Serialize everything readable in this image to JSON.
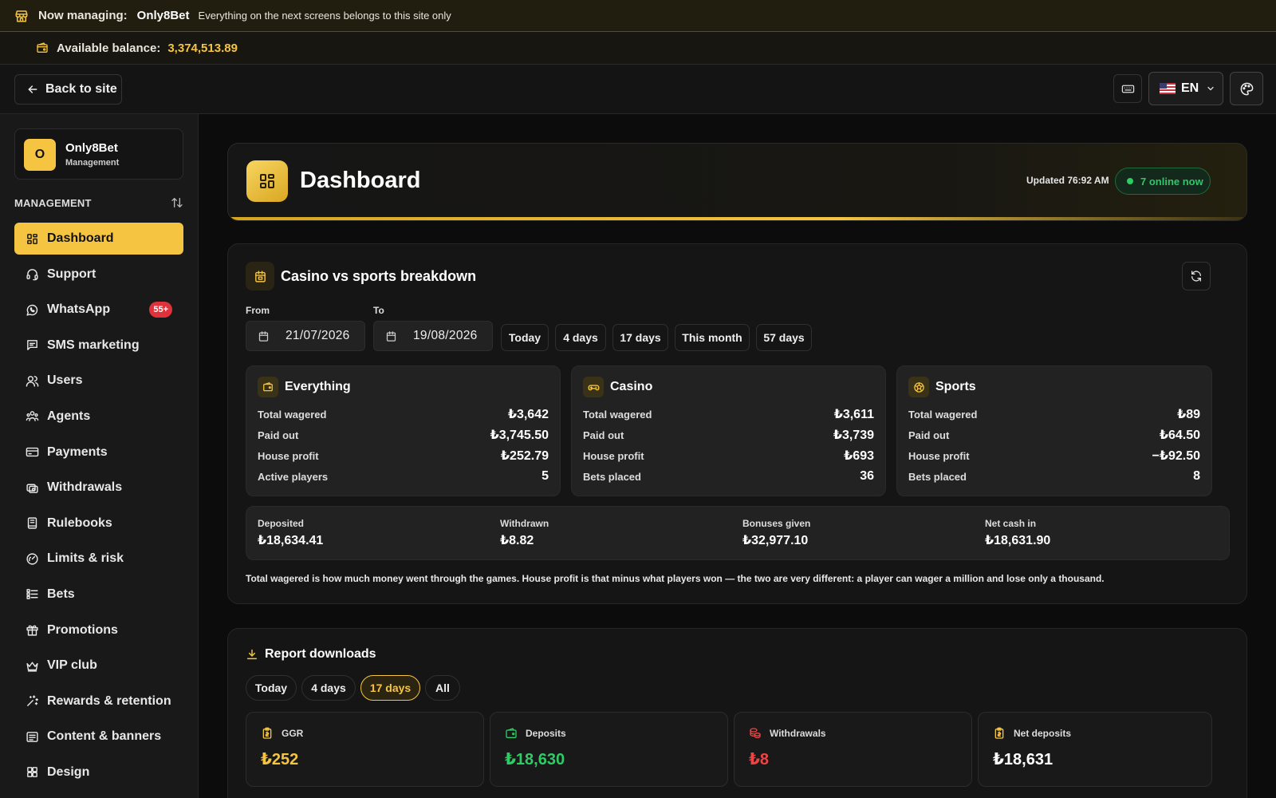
{
  "banner": {
    "managing_label": "Now managing:",
    "site_name": "Only8Bet",
    "note": "Everything on the next screens belongs to this site only",
    "balance_label": "Available balance:",
    "balance_value": "3,374,513.89"
  },
  "topbar": {
    "back_label": "Back to site",
    "language": "EN"
  },
  "sidebar": {
    "site_name": "Only8Bet",
    "site_initial": "O",
    "site_role": "Management",
    "section_title": "MANAGEMENT",
    "items": [
      {
        "label": "Dashboard",
        "icon": "grid-icon",
        "active": true
      },
      {
        "label": "Support",
        "icon": "headset-icon"
      },
      {
        "label": "WhatsApp",
        "icon": "whatsapp-icon",
        "badge": "55+"
      },
      {
        "label": "SMS marketing",
        "icon": "message-icon"
      },
      {
        "label": "Users",
        "icon": "users-icon"
      },
      {
        "label": "Agents",
        "icon": "agents-icon"
      },
      {
        "label": "Payments",
        "icon": "card-icon"
      },
      {
        "label": "Withdrawals",
        "icon": "withdraw-icon"
      },
      {
        "label": "Rulebooks",
        "icon": "book-icon"
      },
      {
        "label": "Limits & risk",
        "icon": "gauge-icon"
      },
      {
        "label": "Bets",
        "icon": "list-icon"
      },
      {
        "label": "Promotions",
        "icon": "gift-icon"
      },
      {
        "label": "VIP club",
        "icon": "crown-icon"
      },
      {
        "label": "Rewards & retention",
        "icon": "sparkle-icon"
      },
      {
        "label": "Content & banners",
        "icon": "content-icon"
      },
      {
        "label": "Design",
        "icon": "design-icon"
      }
    ]
  },
  "header": {
    "title": "Dashboard",
    "updated": "Updated 76:92 AM",
    "online": "7 online now"
  },
  "breakdown": {
    "title": "Casino vs sports breakdown",
    "from_label": "From",
    "to_label": "To",
    "from_value": "21/07/2026",
    "to_value": "19/08/2026",
    "ranges": [
      "Today",
      "4 days",
      "17 days",
      "This month",
      "57 days"
    ],
    "summaries": [
      {
        "title": "Everything",
        "rows": [
          {
            "label": "Total wagered",
            "value": "₺3,642"
          },
          {
            "label": "Paid out",
            "value": "₺3,745.50"
          },
          {
            "label": "House profit",
            "value": "₺252.79"
          },
          {
            "label": "Active players",
            "value": "5"
          }
        ]
      },
      {
        "title": "Casino",
        "rows": [
          {
            "label": "Total wagered",
            "value": "₺3,611"
          },
          {
            "label": "Paid out",
            "value": "₺3,739"
          },
          {
            "label": "House profit",
            "value": "₺693"
          },
          {
            "label": "Bets placed",
            "value": "36"
          }
        ]
      },
      {
        "title": "Sports",
        "rows": [
          {
            "label": "Total wagered",
            "value": "₺89"
          },
          {
            "label": "Paid out",
            "value": "₺64.50"
          },
          {
            "label": "House profit",
            "value": "−₺92.50"
          },
          {
            "label": "Bets placed",
            "value": "8"
          }
        ]
      }
    ],
    "flows": [
      {
        "label": "Deposited",
        "value": "₺18,634.41"
      },
      {
        "label": "Withdrawn",
        "value": "₺8.82"
      },
      {
        "label": "Bonuses given",
        "value": "₺32,977.10"
      },
      {
        "label": "Net cash in",
        "value": "₺18,631.90"
      }
    ],
    "footnote": "Total wagered is how much money went through the games. House profit is that minus what players won — the two are very different: a player can wager a million and lose only a thousand."
  },
  "reports": {
    "title": "Report downloads",
    "ranges": [
      "Today",
      "4 days",
      "17 days",
      "All"
    ],
    "active_range": "17 days",
    "cards": [
      {
        "label": "GGR",
        "value": "₺252",
        "color": "#f5c542"
      },
      {
        "label": "Deposits",
        "value": "₺18,630",
        "color": "#2ecc65"
      },
      {
        "label": "Withdrawals",
        "value": "₺8",
        "color": "#ef4444"
      },
      {
        "label": "Net deposits",
        "value": "₺18,631",
        "color": "#ffffff"
      }
    ]
  },
  "colors": {
    "accent": "#f5c542",
    "positive": "#2ecc65",
    "negative": "#ef4444",
    "badge": "#e0323a"
  }
}
